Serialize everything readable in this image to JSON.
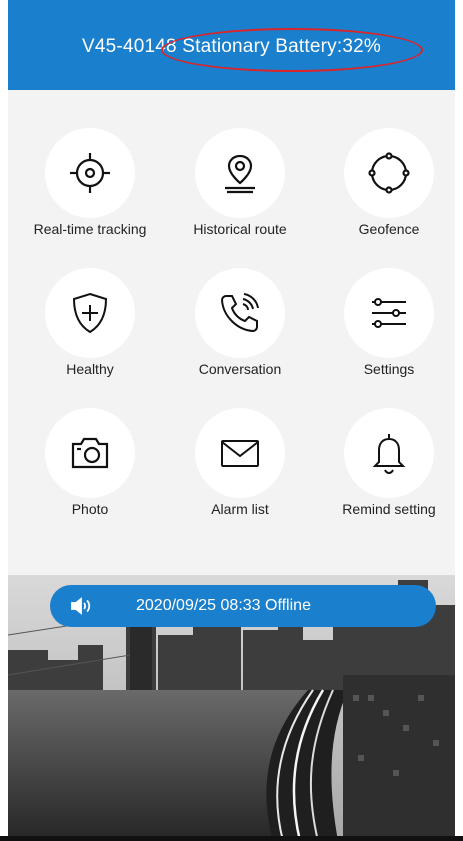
{
  "header": {
    "title": "V45-40148 Stationary Battery:32%",
    "annotation_color": "#d8262c"
  },
  "menu": {
    "items": [
      {
        "label": "Real-time tracking",
        "icon": "crosshair-icon"
      },
      {
        "label": "Historical route",
        "icon": "location-pin-icon"
      },
      {
        "label": "Geofence",
        "icon": "geofence-icon"
      },
      {
        "label": "Healthy",
        "icon": "shield-plus-icon"
      },
      {
        "label": "Conversation",
        "icon": "phone-icon"
      },
      {
        "label": "Settings",
        "icon": "sliders-icon"
      },
      {
        "label": "Photo",
        "icon": "camera-icon"
      },
      {
        "label": "Alarm list",
        "icon": "envelope-icon"
      },
      {
        "label": "Remind setting",
        "icon": "bell-icon"
      }
    ]
  },
  "status": {
    "text": "2020/09/25 08:33 Offline",
    "icon": "speaker-icon"
  },
  "colors": {
    "primary": "#1a7fcc",
    "background": "#f3f3f3"
  }
}
